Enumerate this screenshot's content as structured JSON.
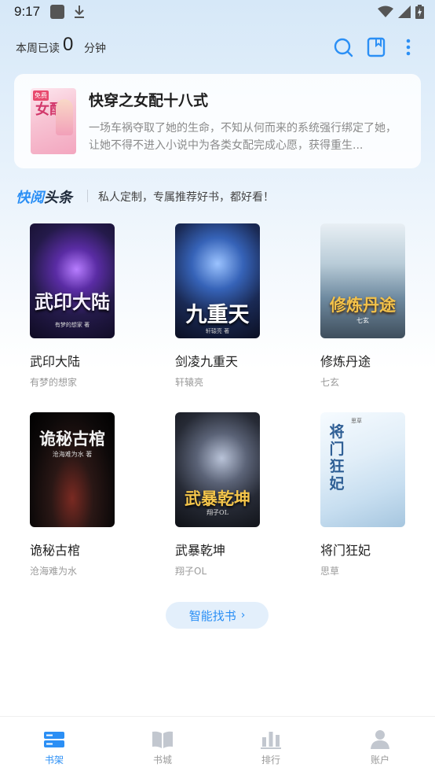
{
  "status_bar": {
    "time": "9:17",
    "icons": [
      "app-square-icon",
      "download-icon",
      "wifi-icon",
      "signal-icon",
      "battery-charging-icon"
    ]
  },
  "header": {
    "reading_label": "本周已读",
    "reading_value": "0",
    "reading_unit": "分钟",
    "icons": [
      "search-icon",
      "book-icon",
      "more-vertical-icon"
    ]
  },
  "featured": {
    "title": "快穿之女配十八式",
    "description": "一场车祸夺取了她的生命，不知从何而来的系统强行绑定了她，让她不得不进入小说中为各类女配完成心愿，获得重生...",
    "cover_text": "女配",
    "cover_tag": "免费"
  },
  "headline": {
    "brand_part1": "快阅",
    "brand_part2": "头条",
    "text": "私人定制，专属推荐好书，都好看！"
  },
  "books": [
    {
      "title": "武印大陆",
      "author": "有梦的想家",
      "cover_text": "武印大陆",
      "cover_sub": "有梦的想家 著"
    },
    {
      "title": "剑凌九重天",
      "author": "轩辕亮",
      "cover_text": "九重天",
      "cover_sub": "轩辕亮 著"
    },
    {
      "title": "修炼丹途",
      "author": "七玄",
      "cover_text": "修炼丹途",
      "cover_sub": "七玄"
    },
    {
      "title": "诡秘古棺",
      "author": "沧海难为水",
      "cover_text": "诡秘古棺",
      "cover_sub": "沧海难为水 著"
    },
    {
      "title": "武暴乾坤",
      "author": "翔子OL",
      "cover_text": "武暴乾坤",
      "cover_sub": "翔子OL"
    },
    {
      "title": "将门狂妃",
      "author": "思草",
      "cover_text": "将门狂妃",
      "cover_sub": "思草"
    }
  ],
  "smart_button": {
    "label": "智能找书",
    "arrow": "›"
  },
  "bottom_nav": [
    {
      "label": "书架",
      "icon": "bookshelf-icon",
      "active": true
    },
    {
      "label": "书城",
      "icon": "open-book-icon",
      "active": false
    },
    {
      "label": "排行",
      "icon": "bar-chart-icon",
      "active": false
    },
    {
      "label": "账户",
      "icon": "user-icon",
      "active": false
    }
  ],
  "colors": {
    "accent": "#2b8ff5",
    "nav_inactive": "#c2c7cf",
    "text_primary": "#1f1f1f",
    "text_secondary": "#9a9a9a"
  }
}
